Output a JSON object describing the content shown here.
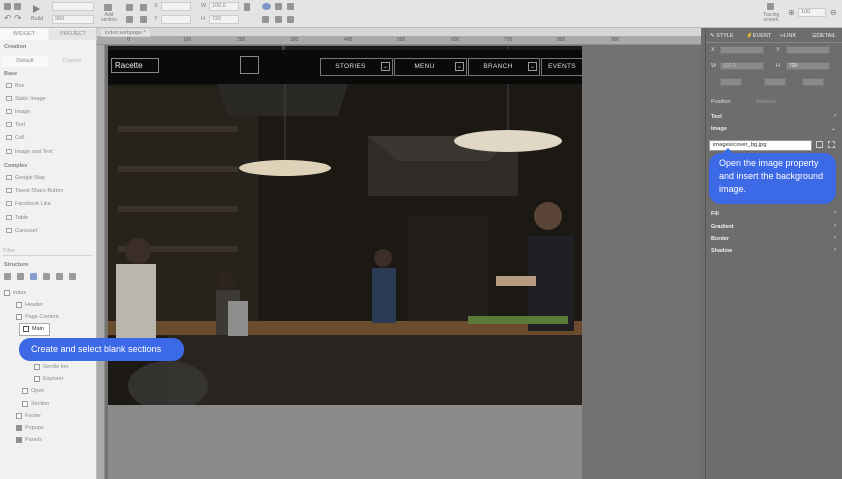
{
  "toolbar": {
    "build_label": "Build",
    "width_value": "960",
    "add_section_label": "Add section",
    "x_label": "X",
    "y_label": "Y",
    "w_label": "W",
    "h_label": "H",
    "w_value": "100.0",
    "h_value": "720",
    "tracing_label": "Tracing screen",
    "zoom_value": "100"
  },
  "left_panel": {
    "tabs": [
      "WIDGET",
      "PROJECT"
    ],
    "creation_label": "Creation",
    "subtabs": [
      "Default",
      "Custom"
    ],
    "base_label": "Base",
    "base_items": [
      "Box",
      "Static Image",
      "Image",
      "Text",
      "Cell",
      "Image and Text"
    ],
    "complex_label": "Complex",
    "complex_items": [
      "Google Map",
      "Tweet Share Button",
      "Facebook Like",
      "Table",
      "Carousel"
    ],
    "filter_placeholder": "Filter",
    "structure_label": "Structure",
    "tree": [
      {
        "label": "index",
        "depth": 0
      },
      {
        "label": "Header",
        "depth": 1
      },
      {
        "label": "Page Content",
        "depth": 1
      },
      {
        "label": "Main",
        "depth": 2
      },
      {
        "label": "Gentle Inn",
        "depth": 3
      },
      {
        "label": "Explorer",
        "depth": 3
      },
      {
        "label": "Open",
        "depth": 2
      },
      {
        "label": "Section",
        "depth": 2
      },
      {
        "label": "Footer",
        "depth": 1
      },
      {
        "label": "Popups",
        "depth": 1
      },
      {
        "label": "Panels",
        "depth": 1
      }
    ]
  },
  "document": {
    "tab_label": "index.webpage *",
    "ruler_marks": [
      "0",
      "100",
      "200",
      "300",
      "400",
      "500",
      "600",
      "700",
      "800",
      "900"
    ]
  },
  "site": {
    "logo_text": "Racette",
    "nav": [
      "STORIES",
      "MENU",
      "BRANCH",
      "EVENTS"
    ]
  },
  "right_panel": {
    "tabs": [
      "STYLE",
      "EVENT",
      "LINK",
      "DETAIL"
    ],
    "x_label": "X",
    "y_label": "Y",
    "w_label": "W",
    "h_label": "H",
    "w_value": "100.0",
    "h_value": "720",
    "position_label": "Position",
    "position_value": "Relative",
    "sections": [
      "Text",
      "Image",
      "Fill",
      "Gradient",
      "Border",
      "Shadow"
    ],
    "image_value": "images/cover_bg.jpg"
  },
  "tooltips": {
    "left": "Create and select blank sections",
    "right": "Open the image property and insert the background image."
  },
  "colors": {
    "tooltip": "#3c69e6",
    "overlay": "#6e6e6e"
  }
}
